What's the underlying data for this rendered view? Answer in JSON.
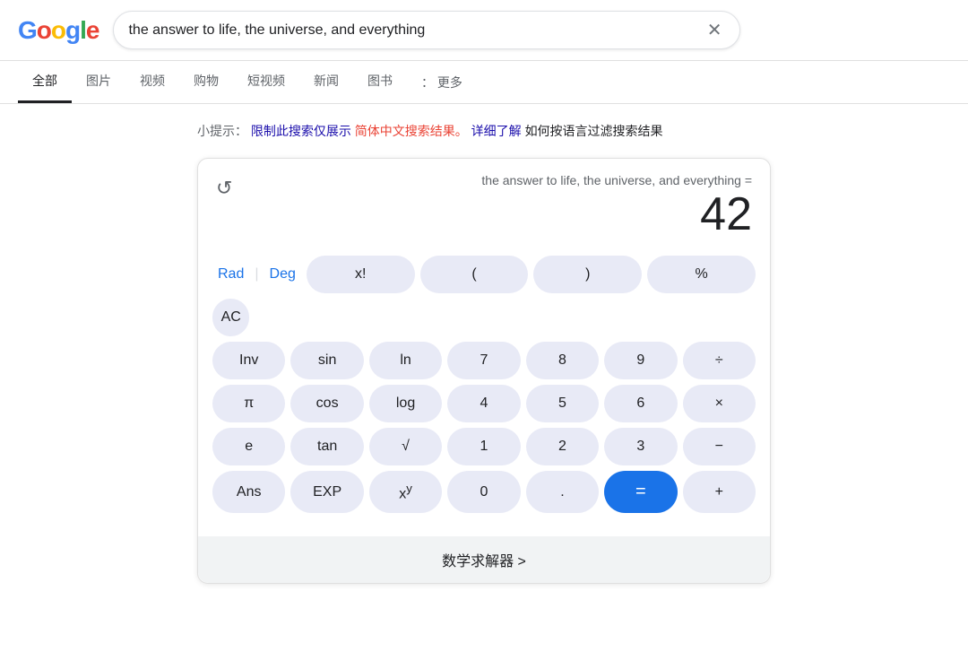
{
  "header": {
    "logo_letters": [
      "G",
      "o",
      "o",
      "g",
      "l",
      "e"
    ],
    "search_value": "the answer to life, the universe, and everything",
    "close_icon": "✕"
  },
  "nav": {
    "tabs": [
      {
        "label": "全部",
        "active": true
      },
      {
        "label": "图片",
        "active": false
      },
      {
        "label": "视频",
        "active": false
      },
      {
        "label": "购物",
        "active": false
      },
      {
        "label": "短视频",
        "active": false
      },
      {
        "label": "新闻",
        "active": false
      },
      {
        "label": "图书",
        "active": false
      }
    ],
    "more_label": "： 更多"
  },
  "tip": {
    "prefix": "小提示：",
    "link_restrict": "限制此搜索仅展示",
    "link_chinese": "简体中文搜索结果。",
    "link_detail": "详细了解",
    "suffix": "如何按语言过滤搜索结果"
  },
  "calculator": {
    "history_icon": "↺",
    "expression": "the answer to life, the universe, and everything =",
    "answer": "42",
    "rows": [
      [
        {
          "label": "Rad",
          "type": "mode"
        },
        {
          "label": "|",
          "type": "separator"
        },
        {
          "label": "Deg",
          "type": "mode"
        },
        {
          "label": "x!",
          "type": "normal"
        },
        {
          "label": "(",
          "type": "normal"
        },
        {
          "label": ")",
          "type": "normal"
        },
        {
          "label": "%",
          "type": "normal"
        },
        {
          "label": "AC",
          "type": "normal"
        }
      ],
      [
        {
          "label": "Inv",
          "type": "normal"
        },
        {
          "label": "sin",
          "type": "normal"
        },
        {
          "label": "ln",
          "type": "normal"
        },
        {
          "label": "7",
          "type": "normal"
        },
        {
          "label": "8",
          "type": "normal"
        },
        {
          "label": "9",
          "type": "normal"
        },
        {
          "label": "÷",
          "type": "normal"
        }
      ],
      [
        {
          "label": "π",
          "type": "normal"
        },
        {
          "label": "cos",
          "type": "normal"
        },
        {
          "label": "log",
          "type": "normal"
        },
        {
          "label": "4",
          "type": "normal"
        },
        {
          "label": "5",
          "type": "normal"
        },
        {
          "label": "6",
          "type": "normal"
        },
        {
          "label": "×",
          "type": "normal"
        }
      ],
      [
        {
          "label": "e",
          "type": "normal"
        },
        {
          "label": "tan",
          "type": "normal"
        },
        {
          "label": "√",
          "type": "normal"
        },
        {
          "label": "1",
          "type": "normal"
        },
        {
          "label": "2",
          "type": "normal"
        },
        {
          "label": "3",
          "type": "normal"
        },
        {
          "label": "−",
          "type": "normal"
        }
      ],
      [
        {
          "label": "Ans",
          "type": "normal"
        },
        {
          "label": "EXP",
          "type": "normal"
        },
        {
          "label": "xʸ",
          "type": "normal"
        },
        {
          "label": "0",
          "type": "normal"
        },
        {
          "label": ".",
          "type": "normal"
        },
        {
          "label": "=",
          "type": "equals"
        },
        {
          "label": "+",
          "type": "normal"
        }
      ]
    ],
    "math_solver_label": "数学求解器 >"
  }
}
